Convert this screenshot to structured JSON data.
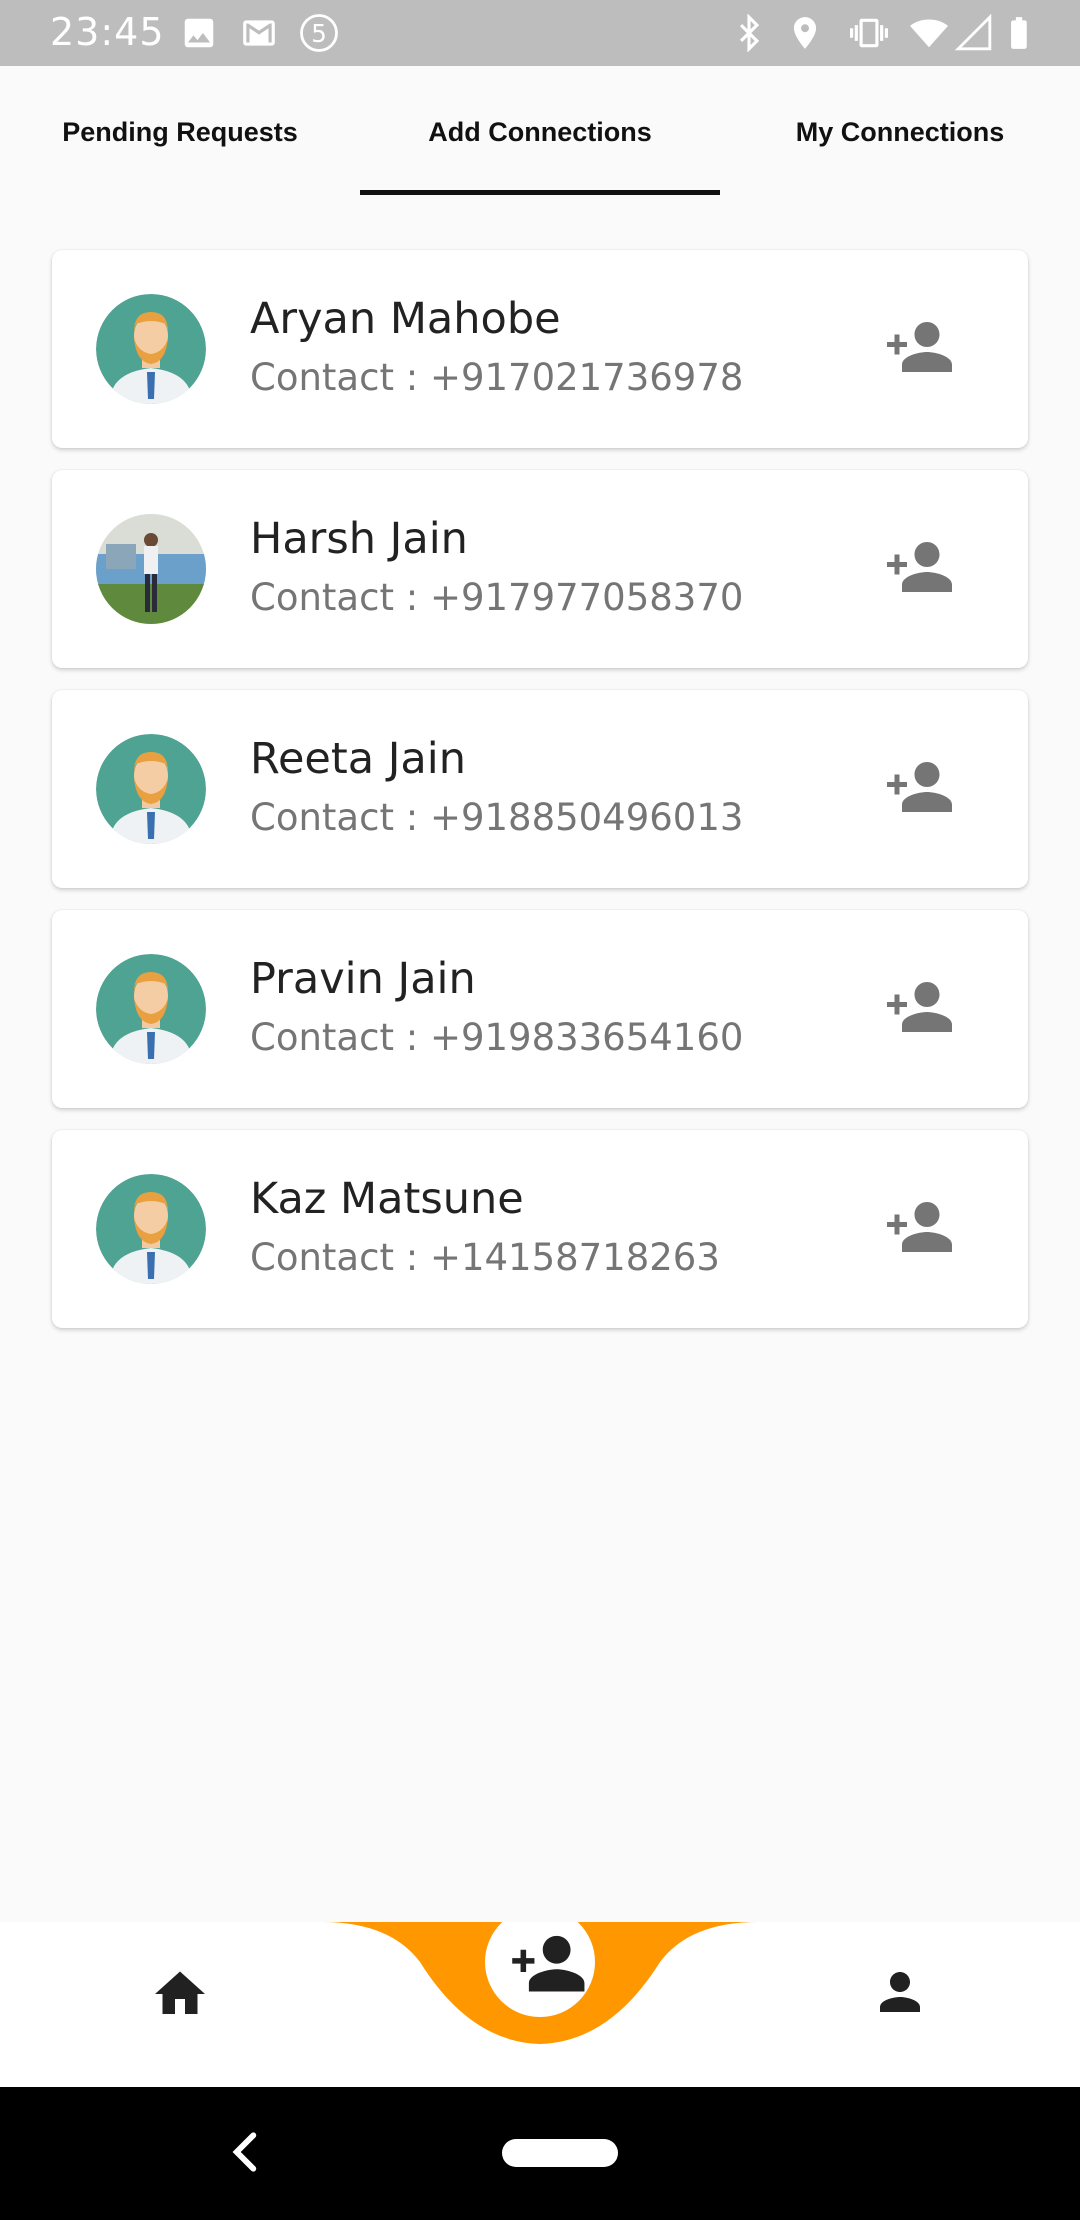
{
  "status_bar": {
    "time": "23:45",
    "left_icons": [
      "image-icon",
      "gmail-icon",
      "five-icon"
    ],
    "right_icons": [
      "bluetooth-icon",
      "location-icon",
      "vibrate-icon",
      "wifi-icon",
      "signal-icon",
      "battery-icon"
    ]
  },
  "tabs": [
    {
      "label": "Pending Requests"
    },
    {
      "label": "Add Connections",
      "active": true
    },
    {
      "label": "My Connections"
    }
  ],
  "contacts": [
    {
      "name": "Aryan Mahobe",
      "contact": "Contact : +917021736978",
      "avatar": "default-avatar"
    },
    {
      "name": "Harsh Jain",
      "contact": "Contact : +917977058370",
      "avatar": "photo-avatar"
    },
    {
      "name": "Reeta Jain",
      "contact": "Contact : +918850496013",
      "avatar": "default-avatar"
    },
    {
      "name": "Pravin Jain",
      "contact": "Contact : +919833654160",
      "avatar": "default-avatar"
    },
    {
      "name": "Kaz Matsune",
      "contact": "Contact : +14158718263",
      "avatar": "default-avatar"
    }
  ],
  "bottom_nav": {
    "items": [
      "home-icon",
      "add-person-icon",
      "person-icon"
    ],
    "accent": "#ff9800"
  },
  "colors": {
    "status_bar": "#bdbdbd",
    "background": "#fafafa",
    "accent": "#ff9800",
    "icon_gray": "#757575"
  }
}
